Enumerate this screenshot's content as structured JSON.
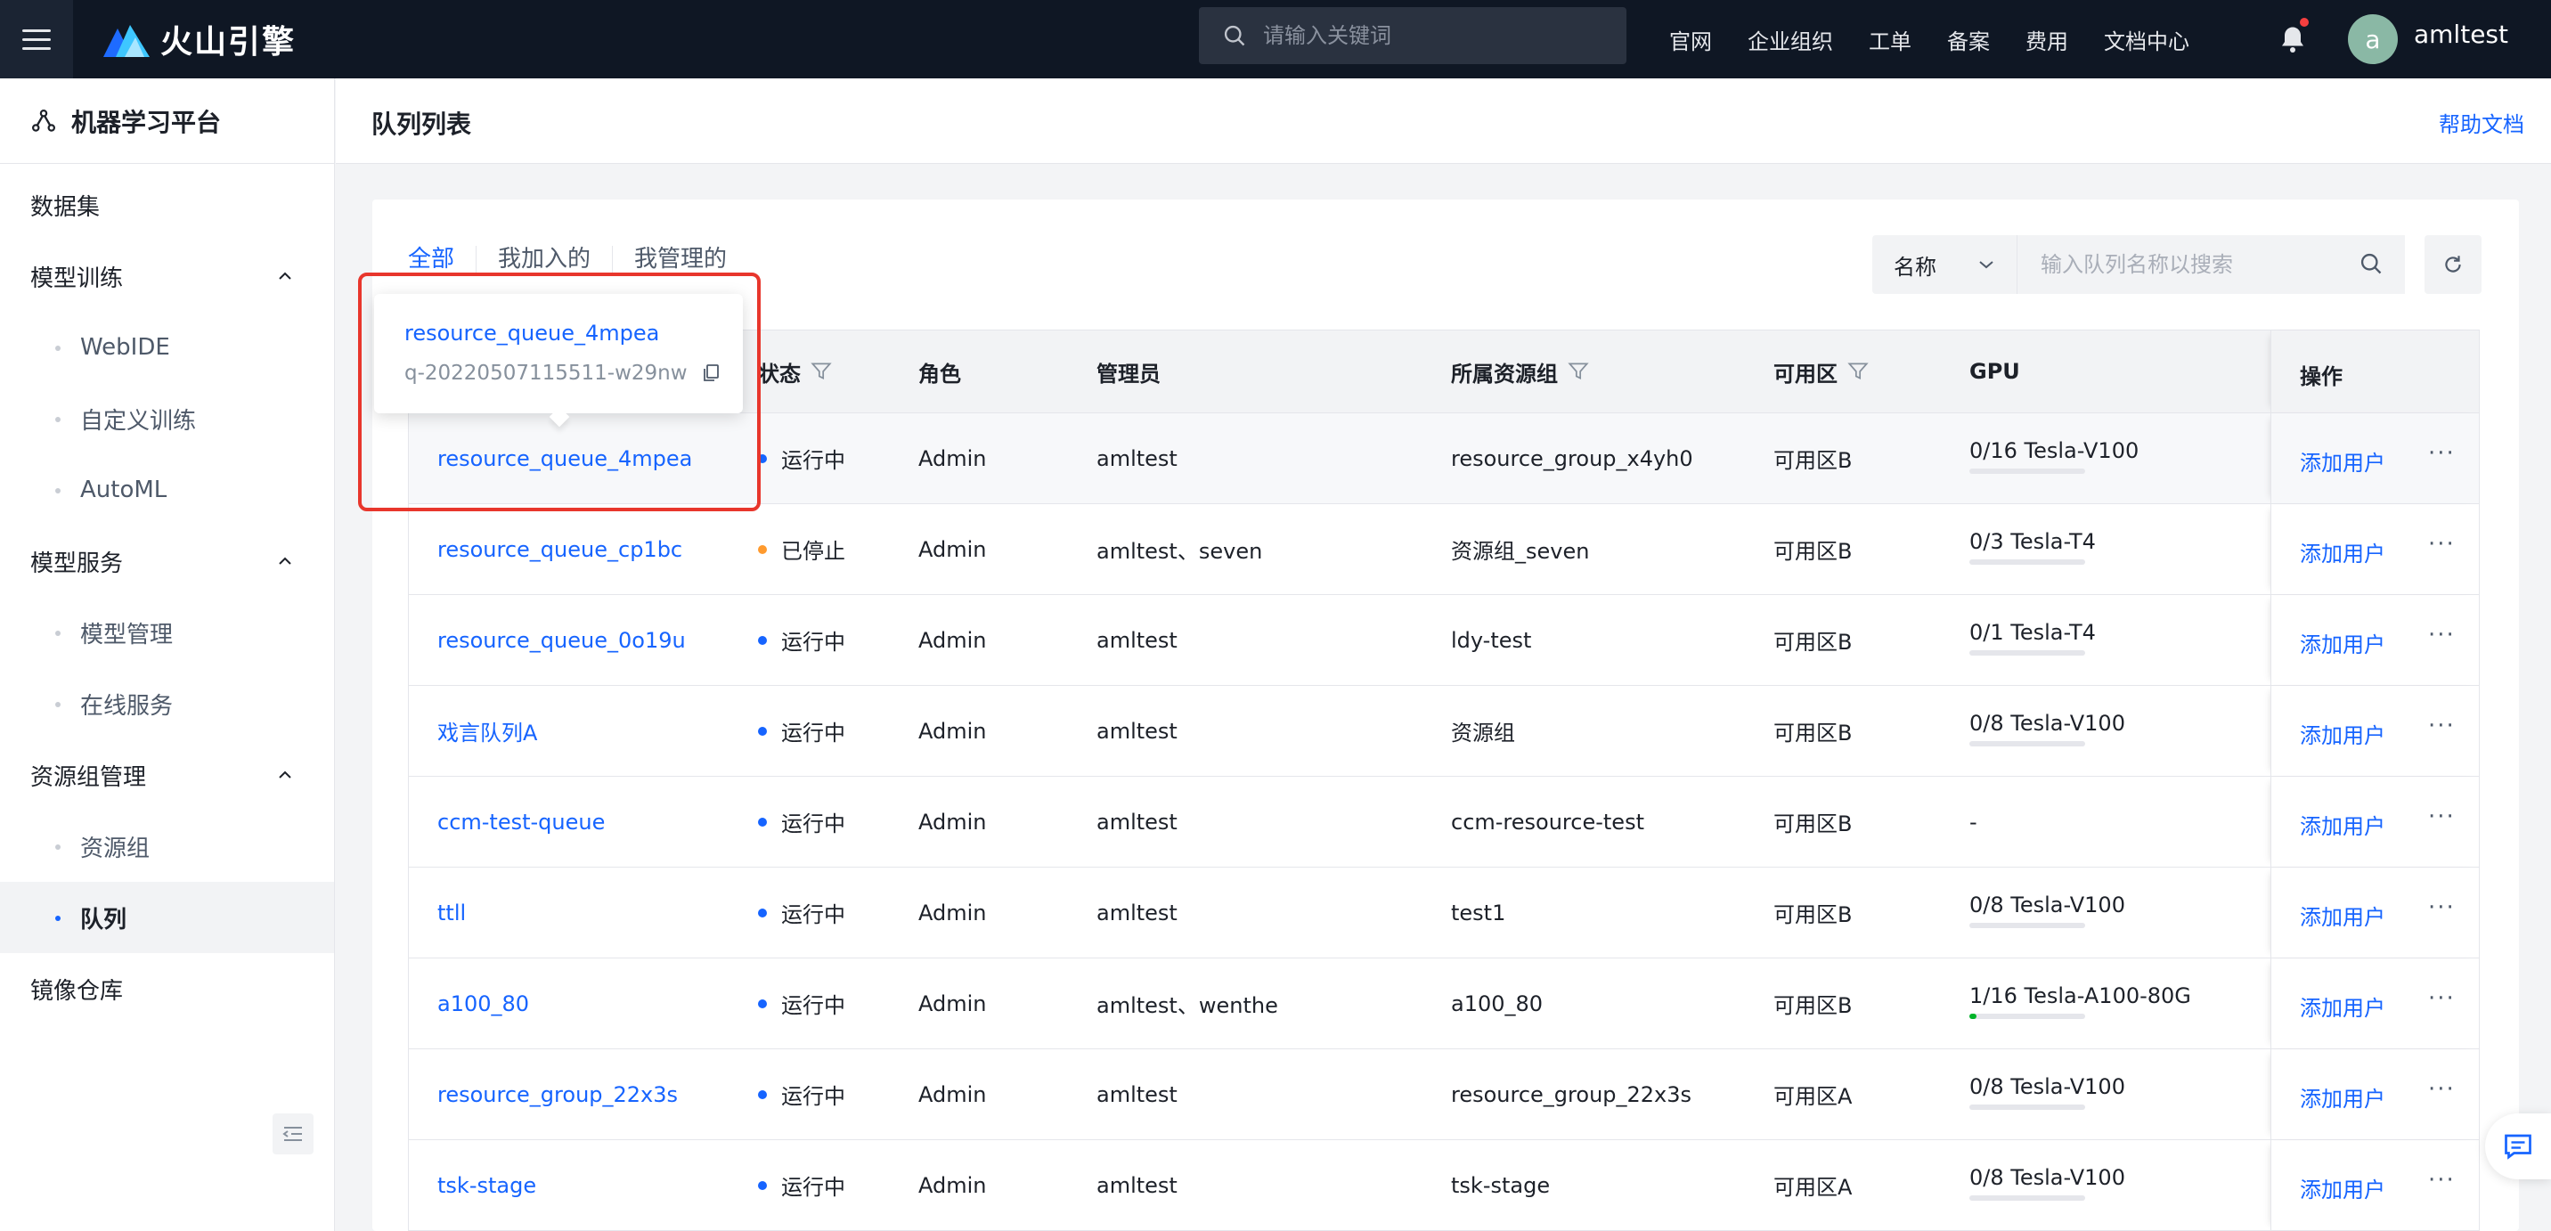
{
  "topbar": {
    "brand": "火山引擎",
    "search_placeholder": "请输入关键词",
    "nav": [
      "官网",
      "企业组织",
      "工单",
      "备案",
      "费用",
      "文档中心"
    ],
    "avatar_letter": "a",
    "username": "amltest"
  },
  "sidebar": {
    "title": "机器学习平台",
    "items": [
      {
        "label": "数据集",
        "type": "item"
      },
      {
        "label": "模型训练",
        "type": "group"
      },
      {
        "label": "WebIDE",
        "type": "sub"
      },
      {
        "label": "自定义训练",
        "type": "sub"
      },
      {
        "label": "AutoML",
        "type": "sub"
      },
      {
        "label": "模型服务",
        "type": "group"
      },
      {
        "label": "模型管理",
        "type": "sub"
      },
      {
        "label": "在线服务",
        "type": "sub"
      },
      {
        "label": "资源组管理",
        "type": "group"
      },
      {
        "label": "资源组",
        "type": "sub"
      },
      {
        "label": "队列",
        "type": "sub",
        "active": true
      },
      {
        "label": "镜像仓库",
        "type": "item"
      }
    ]
  },
  "main": {
    "title": "队列列表",
    "help": "帮助文档",
    "tabs": [
      "全部",
      "我加入的",
      "我管理的"
    ],
    "filter_field": "名称",
    "search_placeholder": "输入队列名称以搜索"
  },
  "table": {
    "headers": {
      "status": "状态",
      "role": "角色",
      "admin": "管理员",
      "group": "所属资源组",
      "zone": "可用区",
      "gpu": "GPU",
      "ops": "操作"
    },
    "action_label": "添加用户",
    "more_label": "···",
    "rows": [
      {
        "name": "resource_queue_4mpea",
        "status": "运行中",
        "status_color": "#1664ff",
        "role": "Admin",
        "admin": "amltest",
        "group": "resource_group_x4yh0",
        "zone": "可用区B",
        "gpu": "0/16 Tesla-V100",
        "gpu_used": 0
      },
      {
        "name": "resource_queue_cp1bc",
        "status": "已停止",
        "status_color": "#ff9a2e",
        "role": "Admin",
        "admin": "amltest、seven",
        "group": "资源组_seven",
        "zone": "可用区B",
        "gpu": "0/3 Tesla-T4",
        "gpu_used": 0
      },
      {
        "name": "resource_queue_0o19u",
        "status": "运行中",
        "status_color": "#1664ff",
        "role": "Admin",
        "admin": "amltest",
        "group": "ldy-test",
        "zone": "可用区B",
        "gpu": "0/1 Tesla-T4",
        "gpu_used": 0
      },
      {
        "name": "戏言队列A",
        "status": "运行中",
        "status_color": "#1664ff",
        "role": "Admin",
        "admin": "amltest",
        "group": "资源组",
        "zone": "可用区B",
        "gpu": "0/8 Tesla-V100",
        "gpu_used": 0
      },
      {
        "name": "ccm-test-queue",
        "status": "运行中",
        "status_color": "#1664ff",
        "role": "Admin",
        "admin": "amltest",
        "group": "ccm-resource-test",
        "zone": "可用区B",
        "gpu": "-",
        "gpu_used": null
      },
      {
        "name": "ttll",
        "status": "运行中",
        "status_color": "#1664ff",
        "role": "Admin",
        "admin": "amltest",
        "group": "test1",
        "zone": "可用区B",
        "gpu": "0/8 Tesla-V100",
        "gpu_used": 0
      },
      {
        "name": "a100_80",
        "status": "运行中",
        "status_color": "#1664ff",
        "role": "Admin",
        "admin": "amltest、wenthe",
        "group": "a100_80",
        "zone": "可用区B",
        "gpu": "1/16 Tesla-A100-80G",
        "gpu_used": 0.0625
      },
      {
        "name": "resource_group_22x3s",
        "status": "运行中",
        "status_color": "#1664ff",
        "role": "Admin",
        "admin": "amltest",
        "group": "resource_group_22x3s",
        "zone": "可用区A",
        "gpu": "0/8 Tesla-V100",
        "gpu_used": 0
      },
      {
        "name": "tsk-stage",
        "status": "运行中",
        "status_color": "#1664ff",
        "role": "Admin",
        "admin": "amltest",
        "group": "tsk-stage",
        "zone": "可用区A",
        "gpu": "0/8 Tesla-V100",
        "gpu_used": 0
      }
    ]
  },
  "popover": {
    "name": "resource_queue_4mpea",
    "id": "q-20220507115511-w29nw"
  },
  "colors": {
    "topbar": "#0f1724",
    "accent": "#1664ff",
    "highlight": "#e8362c"
  }
}
